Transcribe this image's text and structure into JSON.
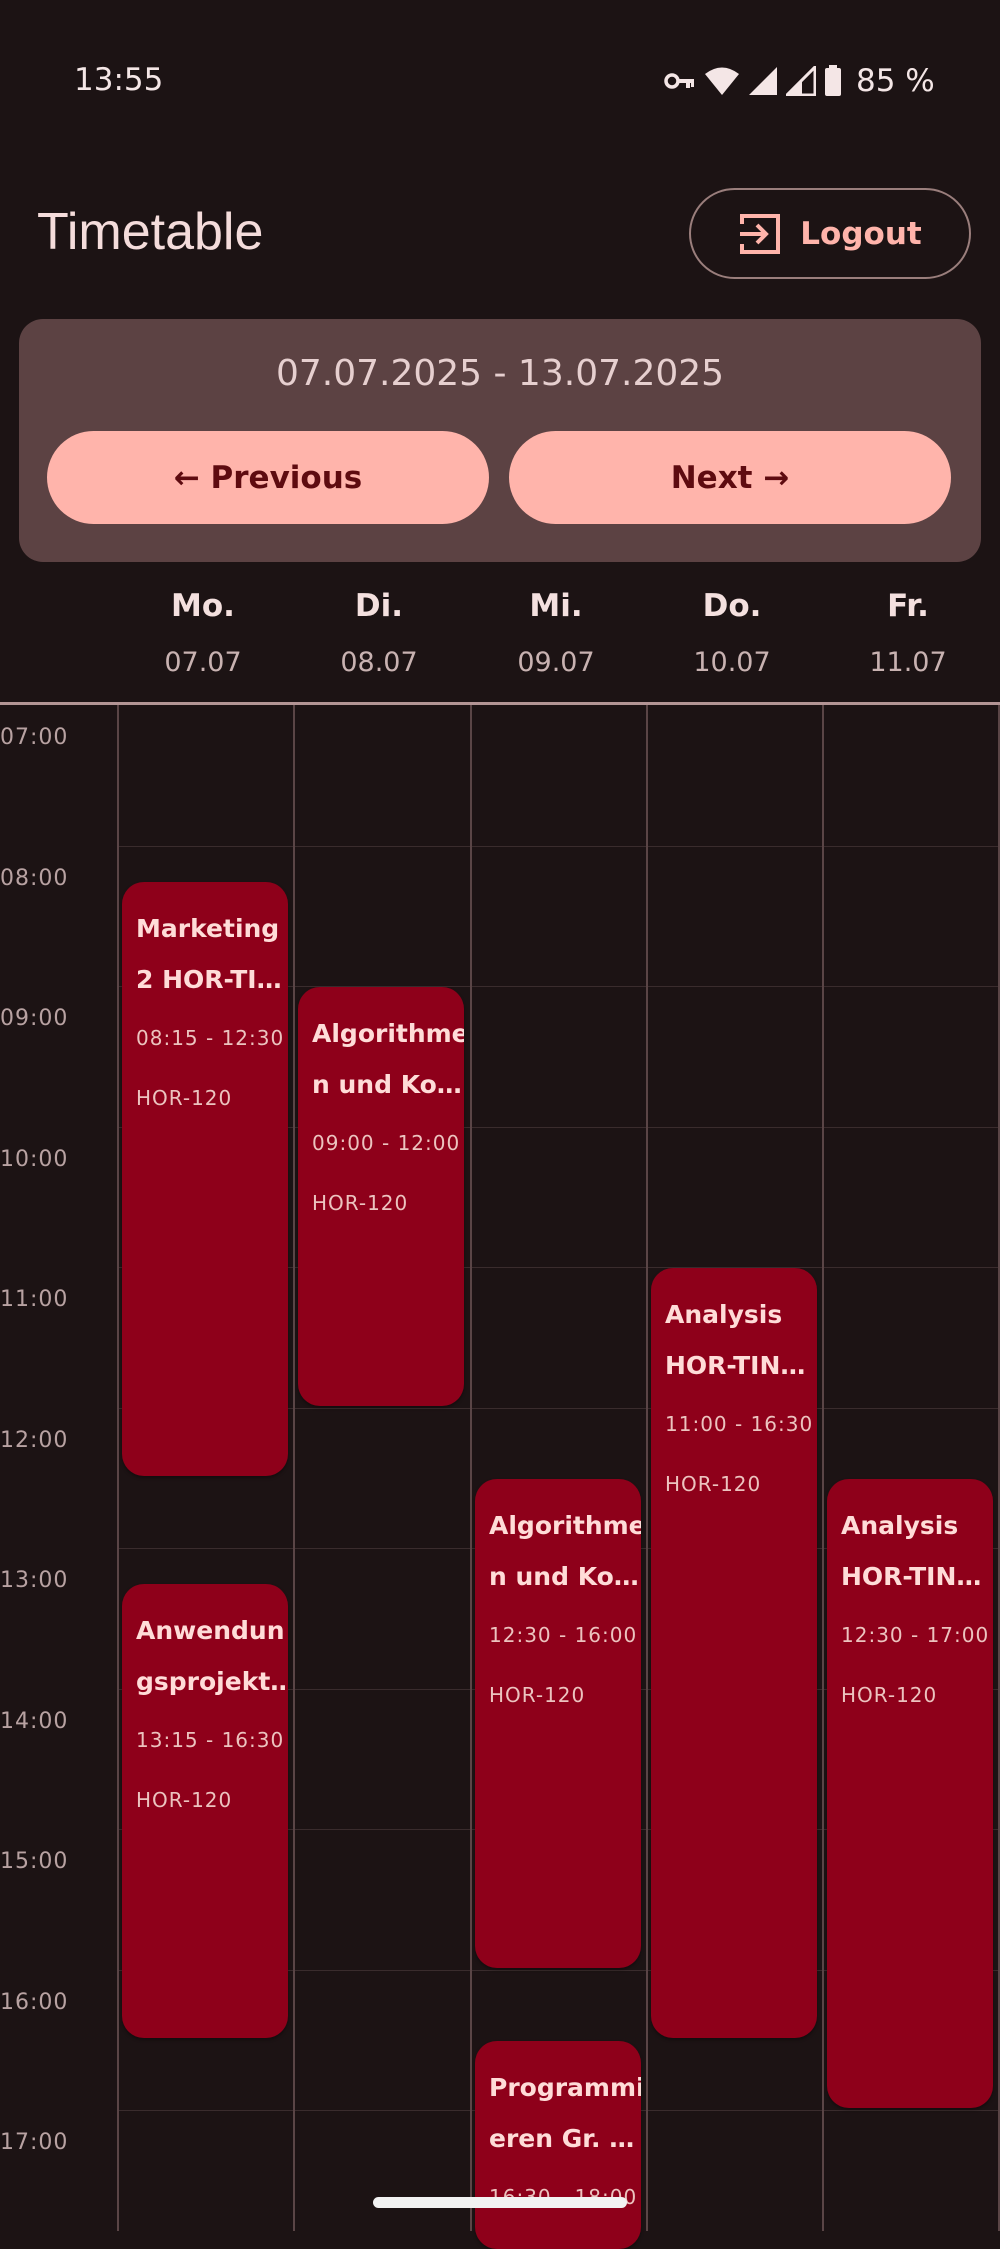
{
  "status_bar": {
    "time": "13:55",
    "battery": "85 %",
    "icons": [
      "vpn-key-icon",
      "wifi-icon",
      "signal-icon",
      "signal-weak-icon",
      "battery-icon"
    ]
  },
  "header": {
    "title": "Timetable",
    "logout_label": "Logout"
  },
  "week": {
    "range": "07.07.2025 - 13.07.2025",
    "previous_label": "← Previous",
    "next_label": "Next →"
  },
  "days": [
    {
      "name": "Mo.",
      "date": "07.07"
    },
    {
      "name": "Di.",
      "date": "08.07"
    },
    {
      "name": "Mi.",
      "date": "09.07"
    },
    {
      "name": "Do.",
      "date": "10.07"
    },
    {
      "name": "Fr.",
      "date": "11.07"
    }
  ],
  "hours": [
    "07:00",
    "08:00",
    "09:00",
    "10:00",
    "11:00",
    "12:00",
    "13:00",
    "14:00",
    "15:00",
    "16:00",
    "17:00"
  ],
  "events": [
    {
      "title1": "Marketing",
      "title2": "2 HOR-TI…",
      "time": "08:15 - 12:30",
      "room": "HOR-120"
    },
    {
      "title1": "Anwendun",
      "title2": "gsprojekt…",
      "time": "13:15 - 16:30",
      "room": "HOR-120"
    },
    {
      "title1": "Algorithme",
      "title2": "n und Ko…",
      "time": "09:00 - 12:00",
      "room": "HOR-120"
    },
    {
      "title1": "Algorithme",
      "title2": "n und Ko…",
      "time": "12:30 - 16:00",
      "room": "HOR-120"
    },
    {
      "title1": "Programmi",
      "title2": "eren Gr. …",
      "time": "16:30 - 18:00",
      "room": ""
    },
    {
      "title1": "Analysis",
      "title2": "HOR-TIN…",
      "time": "11:00 - 16:30",
      "room": "HOR-120"
    },
    {
      "title1": "Analysis",
      "title2": "HOR-TIN…",
      "time": "12:30 - 17:00",
      "room": "HOR-120"
    }
  ],
  "colors": {
    "background": "#1c1314",
    "accent": "#ffb4ab",
    "event": "#8e001a",
    "card": "#5c4243"
  }
}
